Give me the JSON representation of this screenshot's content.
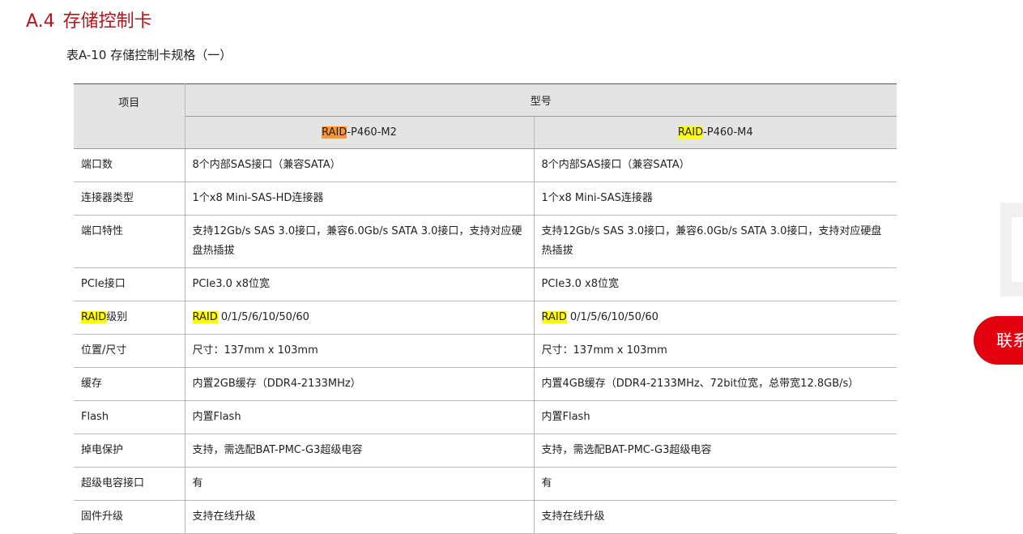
{
  "heading": {
    "number": "A.4",
    "title": "存储控制卡"
  },
  "caption": "表A-10 存储控制卡规格（一）",
  "table": {
    "col_item": "项目",
    "col_model": "型号",
    "models": [
      {
        "prefix": "RAID",
        "suffix": "-P460-M2"
      },
      {
        "prefix": "RAID",
        "suffix": "-P460-M4"
      }
    ],
    "rows": [
      {
        "label": "端口数",
        "v1": "8个内部SAS接口（兼容SATA）",
        "v2": "8个内部SAS接口（兼容SATA）"
      },
      {
        "label": "连接器类型",
        "v1": "1个x8 Mini-SAS-HD连接器",
        "v2": "1个x8 Mini-SAS连接器"
      },
      {
        "label": "端口特性",
        "v1": "支持12Gb/s SAS 3.0接口，兼容6.0Gb/s SATA 3.0接口，支持对应硬盘热插拔",
        "v2": "支持12Gb/s SAS 3.0接口，兼容6.0Gb/s SATA 3.0接口，支持对应硬盘热插拔"
      },
      {
        "label": "PCIe接口",
        "v1": "PCIe3.0 x8位宽",
        "v2": "PCIe3.0 x8位宽"
      },
      {
        "label_hl": "RAID",
        "label_rest": "级别",
        "v1_hl": "RAID",
        "v1_rest": " 0/1/5/6/10/50/60",
        "v2_hl": "RAID",
        "v2_rest": " 0/1/5/6/10/50/60"
      },
      {
        "label": "位置/尺寸",
        "v1": "尺寸：137mm x 103mm",
        "v2": "尺寸：137mm x 103mm"
      },
      {
        "label": "缓存",
        "v1": "内置2GB缓存（DDR4-2133MHz）",
        "v2": "内置4GB缓存（DDR4-2133MHz、72bit位宽，总带宽12.8GB/s）"
      },
      {
        "label": "Flash",
        "v1": "内置Flash",
        "v2": "内置Flash"
      },
      {
        "label": "掉电保护",
        "v1": "支持，需选配BAT-PMC-G3超级电容",
        "v2": "支持，需选配BAT-PMC-G3超级电容"
      },
      {
        "label": "超级电容接口",
        "v1": "有",
        "v2": "有"
      },
      {
        "label": "固件升级",
        "v1": "支持在线升级",
        "v2": "支持在线升级"
      }
    ]
  },
  "contact_button": "联系",
  "colors": {
    "heading": "#b0171c",
    "highlight_yellow": "#ffff00",
    "highlight_orange": "#ff9632",
    "contact": "#e3000f"
  }
}
